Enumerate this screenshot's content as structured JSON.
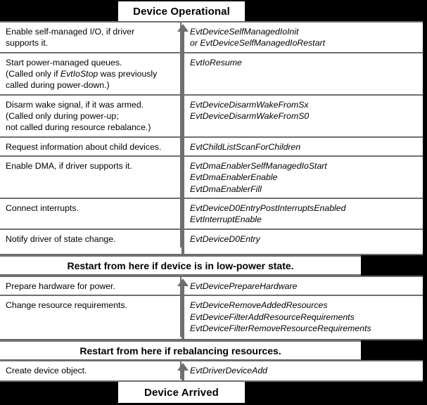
{
  "diagram": {
    "title_top": "Device Operational",
    "title_bottom": "Device Arrived",
    "colors": {
      "background": "#000000",
      "surface": "#ffffff",
      "rule": "#6f6f6f",
      "text": "#000000",
      "arrow": "#6f6f6f"
    },
    "sections": {
      "upper_rows": [
        {
          "task_lines": [
            "Enable self-managed I/O, if driver",
            "supports it."
          ],
          "callback_lines": [
            "EvtDeviceSelfManagedIoInit",
            "or EvtDeviceSelfManagedIoRestart"
          ]
        },
        {
          "task_lines": [
            "Start power-managed queues.",
            "(Called only if EvtIoStop was previously",
            "called during power-down.)"
          ],
          "task_italic_word": "EvtIoStop",
          "callback_lines": [
            "EvtIoResume"
          ]
        },
        {
          "task_lines": [
            "Disarm wake signal, if it was armed.",
            "(Called only during power-up;",
            "not called during resource rebalance.)"
          ],
          "callback_lines": [
            "EvtDeviceDisarmWakeFromSx",
            "EvtDeviceDisarmWakeFromS0"
          ]
        },
        {
          "task_lines": [
            "Request information about child devices."
          ],
          "callback_lines": [
            "EvtChildListScanForChildren"
          ]
        },
        {
          "task_lines": [
            "Enable DMA, if driver supports it."
          ],
          "callback_lines": [
            "EvtDmaEnablerSelfManagedIoStart",
            "EvtDmaEnablerEnable",
            "EvtDmaEnablerFill"
          ]
        },
        {
          "task_lines": [
            "Connect interrupts."
          ],
          "callback_lines": [
            "EvtDeviceD0EntryPostInterruptsEnabled",
            "EvtInterruptEnable"
          ]
        },
        {
          "task_lines": [
            "Notify driver of state change."
          ],
          "callback_lines": [
            "EvtDeviceD0Entry"
          ]
        }
      ],
      "restart_banner_1": "Restart from here if device is in low-power state.",
      "mid_rows": [
        {
          "task_lines": [
            "Prepare hardware for power."
          ],
          "callback_lines": [
            "EvtDevicePrepareHardware"
          ]
        },
        {
          "task_lines": [
            "Change resource requirements."
          ],
          "callback_lines": [
            "EvtDeviceRemoveAddedResources",
            "EvtDeviceFilterAddResourceRequirements",
            "EvtDeviceFilterRemoveResourceRequirements"
          ]
        }
      ],
      "restart_banner_2": "Restart from here if rebalancing resources.",
      "lower_rows": [
        {
          "task_lines": [
            "Create device object."
          ],
          "callback_lines": [
            "EvtDriverDeviceAdd"
          ]
        }
      ]
    }
  }
}
